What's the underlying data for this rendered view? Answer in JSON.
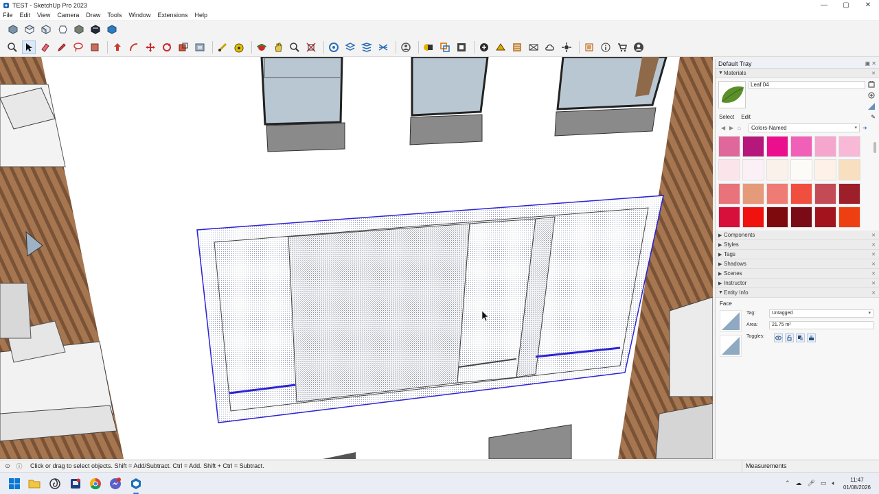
{
  "window": {
    "title": "TEST - SketchUp Pro 2023",
    "minimize": "—",
    "maximize": "▢",
    "close": "✕"
  },
  "menu": [
    "File",
    "Edit",
    "View",
    "Camera",
    "Draw",
    "Tools",
    "Window",
    "Extensions",
    "Help"
  ],
  "toolbar_row1_icons": [
    "iso-view-icon",
    "top-view-icon",
    "front-view-icon",
    "right-view-icon",
    "back-view-icon",
    "left-view-icon",
    "bottom-view-icon"
  ],
  "toolbar_row2_icons": [
    "zoom-icon",
    "select-icon",
    "eraser-icon",
    "pencil-icon",
    "lasso-icon",
    "paint-bucket-icon",
    "push-pull-icon",
    "follow-me-icon",
    "move-icon",
    "rotate-icon",
    "scale-icon",
    "offset-icon",
    "tape-measure-icon",
    "protractor-icon",
    "orbit-icon",
    "pan-icon",
    "zoom-window-icon",
    "zoom-extents-icon",
    "section-plane-icon",
    "layers-icon",
    "tags-icon",
    "styles-icon",
    "user-icon",
    "components-icon",
    "scene-icon",
    "3d-warehouse-icon",
    "extension-icon",
    "sandbox-icon",
    "solid-tools-icon",
    "cloud-icon",
    "settings-icon",
    "outliner-icon",
    "info-icon",
    "cart-icon",
    "account-icon"
  ],
  "tray": {
    "title": "Default Tray",
    "materials": {
      "header": "Materials",
      "name": "Leaf 04",
      "tab_select": "Select",
      "tab_edit": "Edit",
      "library": "Colors-Named",
      "swatches": [
        "#e0679b",
        "#b5177b",
        "#eb0f8e",
        "#f060b8",
        "#f5a6cd",
        "#f8b9d6",
        "#fbe5ea",
        "#fbf0f5",
        "#faf1ea",
        "#fdfbf7",
        "#fdf1e8",
        "#f8dfbf",
        "#e8737b",
        "#e59b7a",
        "#ef7b75",
        "#f04e3f",
        "#c34b55",
        "#9c1f2a",
        "#d60f3b",
        "#f0120f",
        "#7f0a0d",
        "#7a0a15",
        "#a3131e",
        "#ee3f12"
      ]
    },
    "panels": [
      "Components",
      "Styles",
      "Tags",
      "Shadows",
      "Scenes",
      "Instructor"
    ],
    "entity_info": {
      "header": "Entity Info",
      "type": "Face",
      "tag_label": "Tag:",
      "tag_value": "Untagged",
      "area_label": "Area:",
      "area_value": "21.75 m²",
      "toggles_label": "Toggles:"
    }
  },
  "status": {
    "message": "Click or drag to select objects. Shift = Add/Subtract. Ctrl = Add. Shift + Ctrl = Subtract.",
    "measurements_label": "Measurements"
  },
  "taskbar": {
    "time": "11:47",
    "date": "01/08/2026"
  }
}
